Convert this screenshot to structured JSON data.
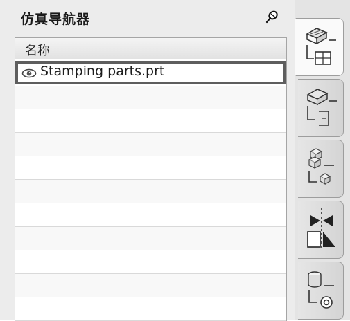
{
  "panel": {
    "title": "仿真导航器",
    "pin_icon": "pin-icon",
    "column_header": "名称",
    "items": [
      {
        "label": "Stamping parts.prt",
        "icon": "eye-icon",
        "selected": true
      }
    ],
    "empty_rows": 9
  },
  "resource_bar": {
    "tabs": [
      {
        "icon": "simulation-navigator-icon",
        "active": true
      },
      {
        "icon": "simulation-file-view-icon",
        "active": false
      },
      {
        "icon": "assembly-navigator-icon",
        "active": false
      },
      {
        "icon": "constraint-navigator-icon",
        "active": false
      },
      {
        "icon": "roles-icon",
        "active": false
      }
    ]
  },
  "colors": {
    "panel_bg": "#ececec",
    "selection_border": "#5e5e5e",
    "active_tab_bg": "#fafafa"
  }
}
